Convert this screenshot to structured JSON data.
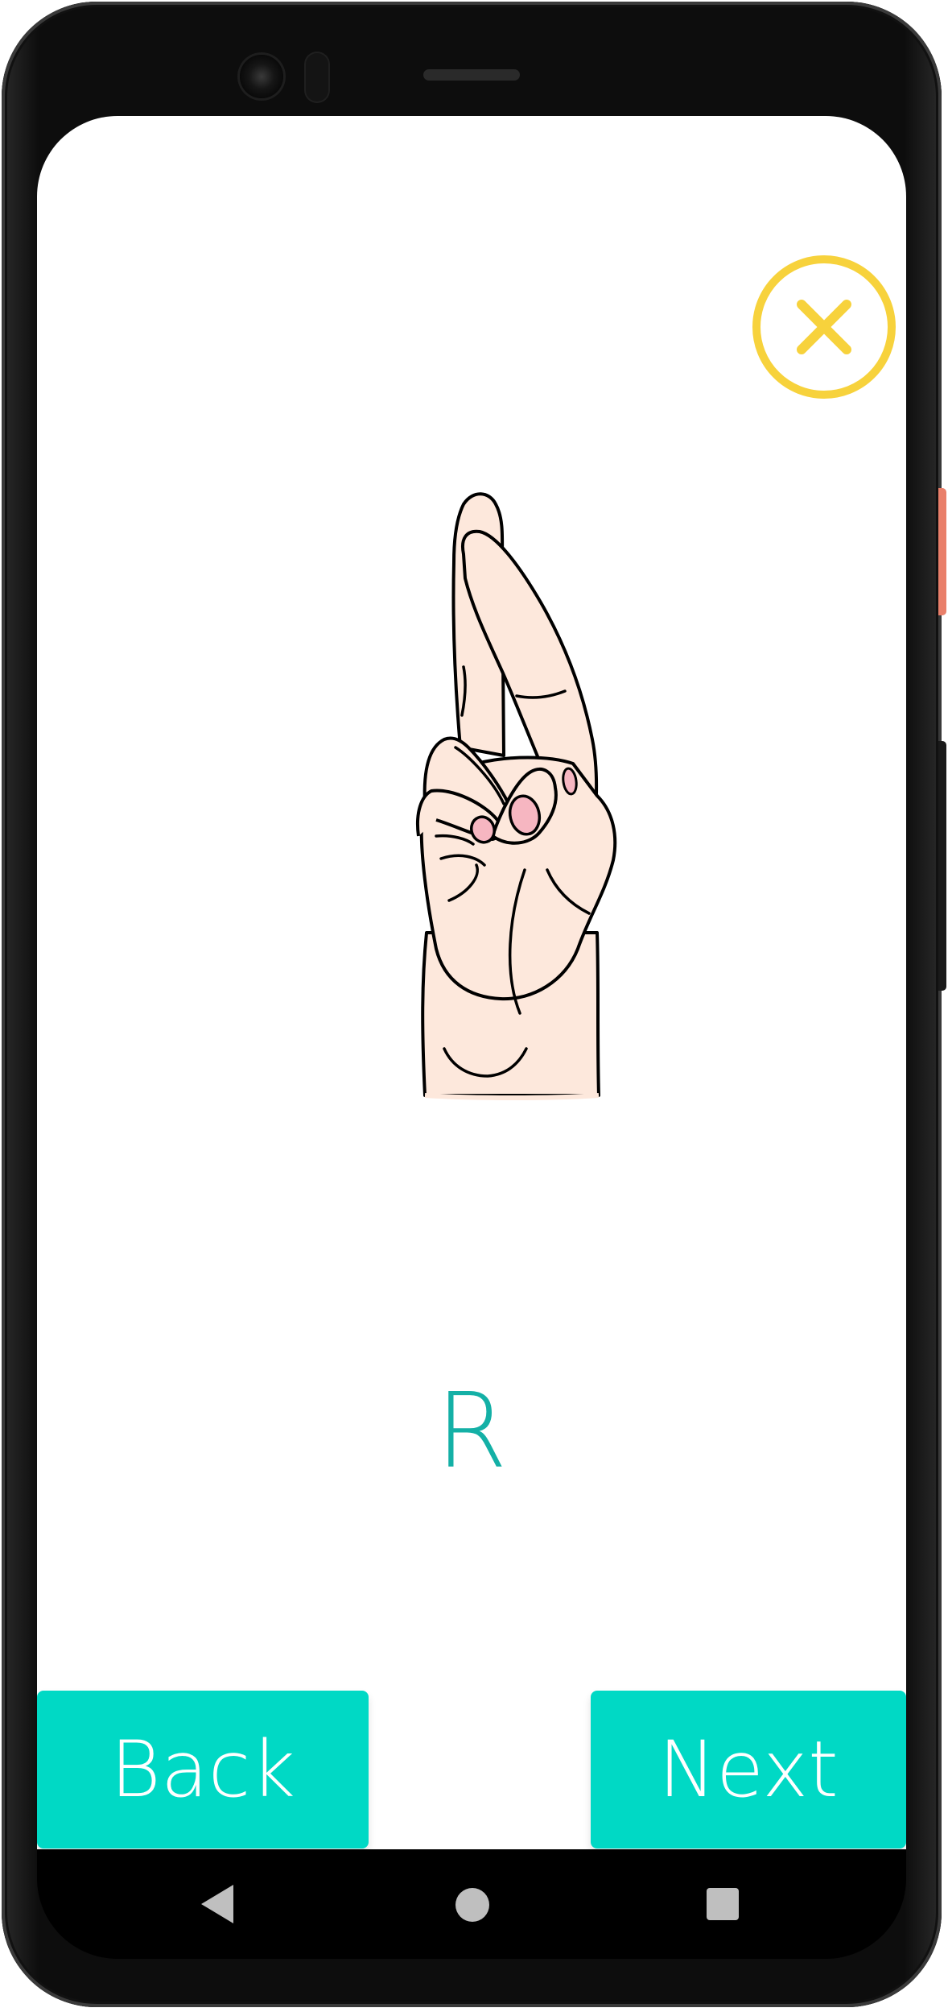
{
  "sign": {
    "letter": "R",
    "image_icon": "hand-sign-r-icon"
  },
  "controls": {
    "close_icon": "close-icon",
    "back_label": "Back",
    "next_label": "Next"
  },
  "system_nav": {
    "back_icon": "nav-back-icon",
    "home_icon": "nav-home-icon",
    "recents_icon": "nav-recents-icon"
  },
  "colors": {
    "accent": "#00d9c5",
    "letter": "#14b0a6",
    "close": "#f7d23c",
    "skin": "#fde8dc",
    "nail": "#f6b6c1"
  }
}
